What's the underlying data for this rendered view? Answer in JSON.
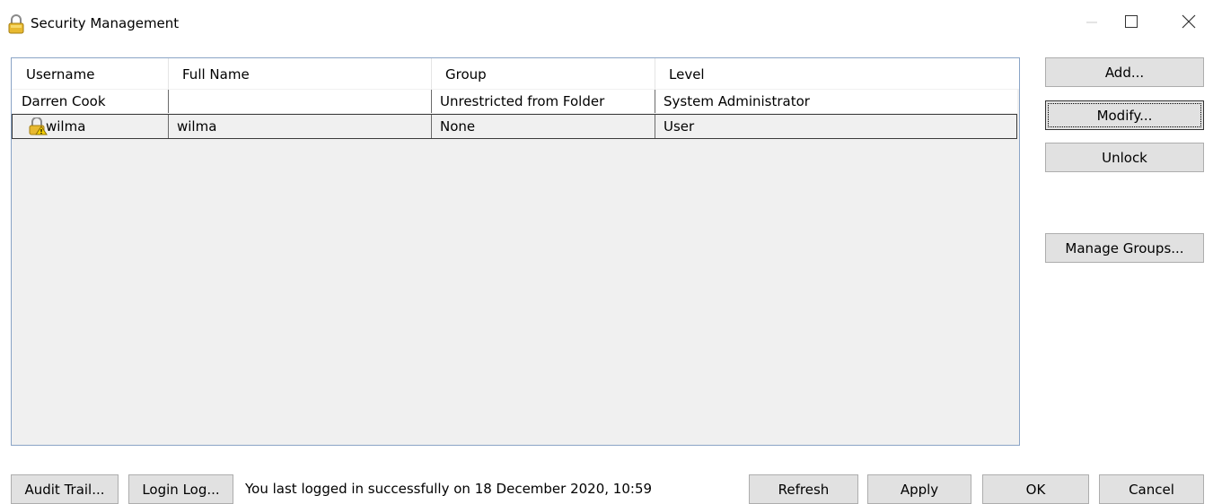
{
  "window": {
    "title": "Security Management",
    "title_icon": "lock-icon",
    "controls": {
      "minimize": "minimize-icon",
      "maximize": "maximize-icon",
      "close": "close-icon"
    }
  },
  "table": {
    "columns": [
      "Username",
      "Full Name",
      "Group",
      "Level"
    ],
    "rows": [
      {
        "username": "Darren Cook",
        "full_name": "",
        "group": "Unrestricted from Folder",
        "level": "System Administrator",
        "icon": ""
      },
      {
        "username": "wilma",
        "full_name": "wilma",
        "group": "None",
        "level": "User",
        "icon": "locked-user-warning-icon"
      }
    ]
  },
  "side_buttons": {
    "add": "Add...",
    "modify": "Modify...",
    "unlock": "Unlock",
    "manage_groups": "Manage Groups..."
  },
  "bottom": {
    "audit_trail": "Audit Trail...",
    "login_log": "Login Log...",
    "status": "You last logged in successfully on 18 December 2020, 10:59",
    "refresh": "Refresh",
    "apply": "Apply",
    "ok": "OK",
    "cancel": "Cancel"
  },
  "colors": {
    "list_border": "#8aa4c6",
    "button_face": "#e1e1e1",
    "lock_gold": "#e8b930",
    "warning_yellow": "#f5d000"
  }
}
